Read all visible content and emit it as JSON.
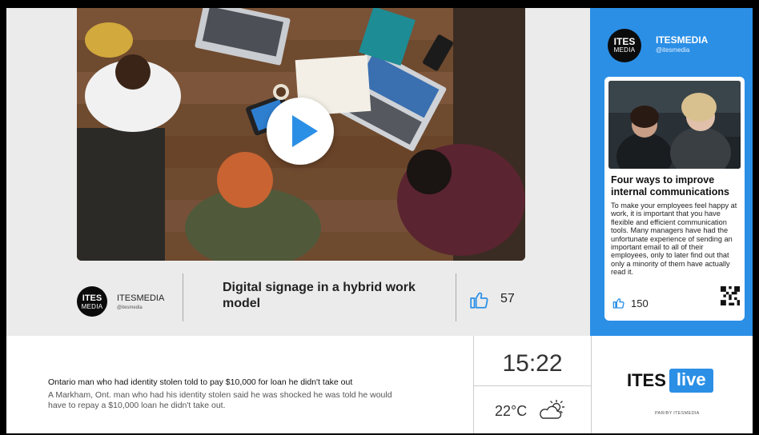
{
  "video": {
    "play_icon": "play-icon"
  },
  "channel": {
    "logo_line1": "ITES",
    "logo_line2": "MEDIA",
    "name": "ITESMEDIA",
    "handle": "@itesmedia"
  },
  "video_title": "Digital signage in a hybrid work model",
  "video_likes": "57",
  "social": {
    "logo_line1": "ITES",
    "logo_line2": "MEDIA",
    "account_name": "ITESMEDIA",
    "account_handle": "@itesmedia",
    "post_title": "Four ways to improve internal communications",
    "post_body": "To make your employees feel happy at work, it is important that you have flexible and efficient communication tools. Many managers have had the unfortunate experience of sending an important email to all of their employees, only to later find out that only a minority of them have actually read it.",
    "post_likes": "150",
    "qr_icon": "qr-code-icon",
    "accent_color": "#2b8fe6"
  },
  "news": {
    "headline": "Ontario man who had identity stolen told to pay $10,000 for loan he didn't take out",
    "summary": "A Markham, Ont. man who had his identity stolen said he was shocked he was told he would have to repay a $10,000 loan he didn't take out."
  },
  "widgets": {
    "time": "15:22",
    "temperature": "22°C",
    "weather_icon": "partly-cloudy-icon"
  },
  "footer_brand": {
    "word": "ITES",
    "live": "live",
    "tagline": "PAR/BY ITESMEDIA"
  }
}
